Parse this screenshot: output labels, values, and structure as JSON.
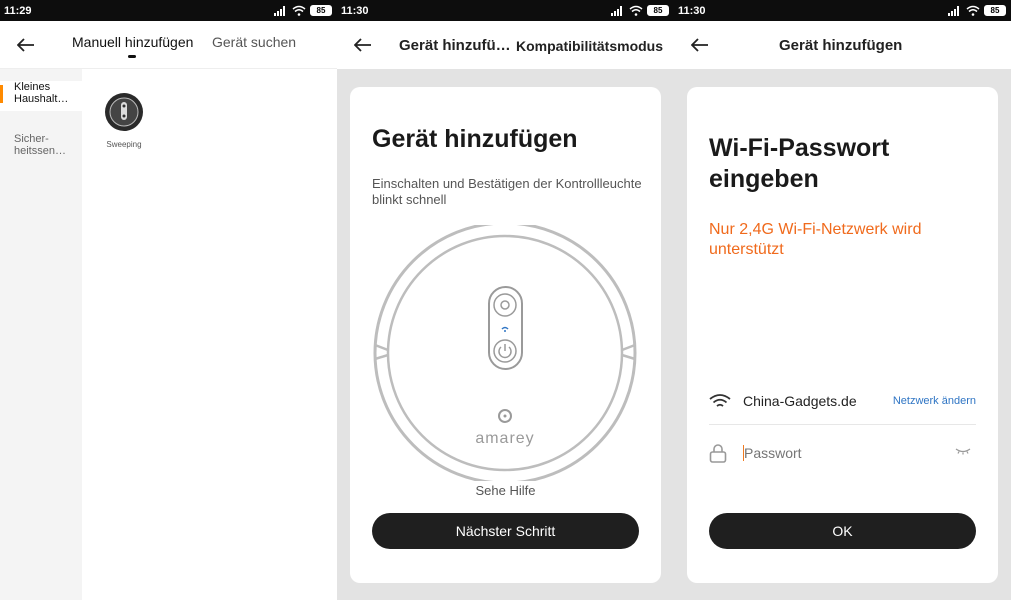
{
  "screen1": {
    "status": {
      "time": "11:29",
      "battery": "85"
    },
    "tabs": [
      {
        "label": "Manuell hinzufügen"
      },
      {
        "label": "Gerät suchen"
      }
    ],
    "categories": [
      {
        "label": "Kleines Haushalt…"
      },
      {
        "label": "Sicher-heitssen…"
      }
    ],
    "device": {
      "label": "Sweeping"
    }
  },
  "screen2": {
    "status": {
      "time": "11:30",
      "battery": "85"
    },
    "title": "Gerät hinzufü…",
    "action": "Kompatibilitätsmodus",
    "heading": "Gerät hinzufügen",
    "description": "Einschalten und Bestätigen der Kontrollleuchte blinkt schnell",
    "brand": "amarey",
    "help": "Sehe Hilfe",
    "next_button": "Nächster Schritt"
  },
  "screen3": {
    "status": {
      "time": "11:30",
      "battery": "85"
    },
    "title": "Gerät hinzufügen",
    "heading": "Wi-Fi-Passwort eingeben",
    "warning": "Nur 2,4G Wi-Fi-Netzwerk wird unterstützt",
    "network": "China-Gadgets.de",
    "change_network": "Netzwerk ändern",
    "password_placeholder": "Passwort",
    "ok_button": "OK"
  },
  "colors": {
    "accent": "#ff8a00",
    "warning": "#f06a1c",
    "link": "#2f75c4",
    "button": "#1f1f1f"
  }
}
